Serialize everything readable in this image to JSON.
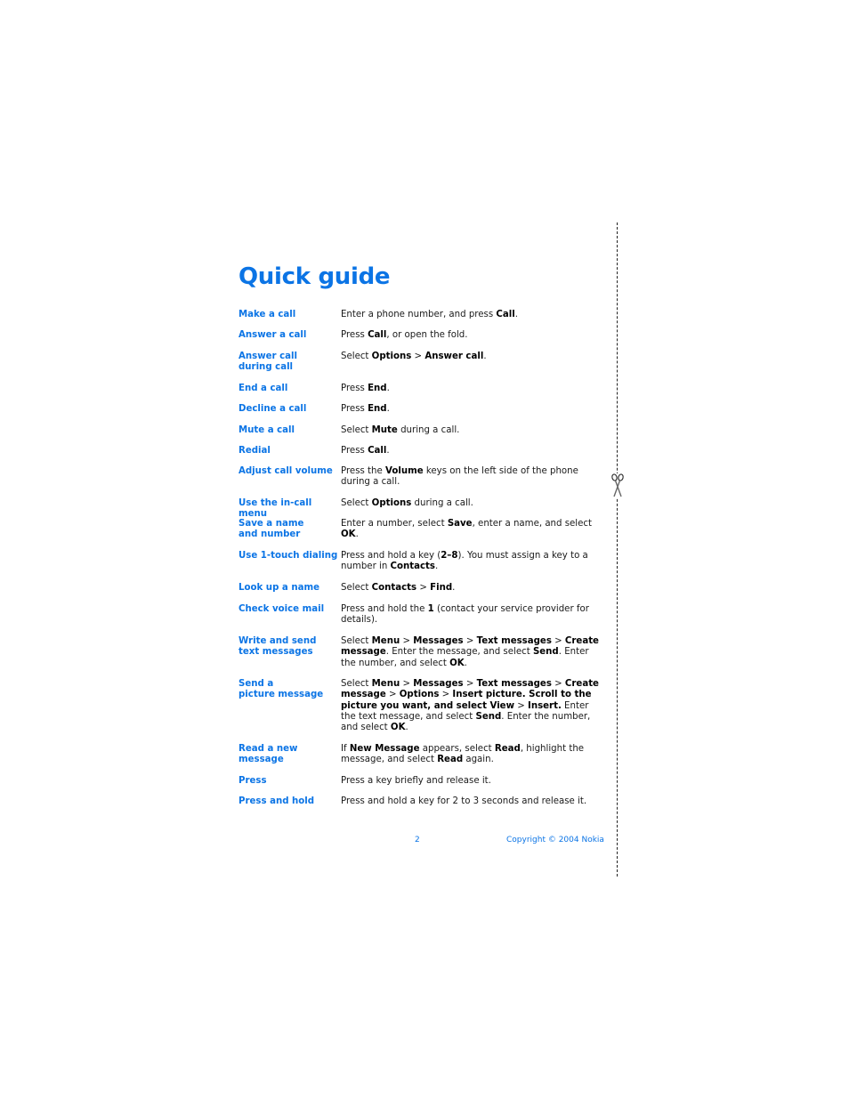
{
  "page": {
    "title": "Quick guide",
    "footer": {
      "page_number": "2",
      "copyright": "Copyright © 2004 Nokia"
    },
    "accent_color": "#0b74e5"
  },
  "rows": [
    {
      "term": "Make a call",
      "def": [
        [
          "Enter a phone number, and press ",
          false
        ],
        [
          "Call",
          true
        ],
        [
          ".",
          false
        ]
      ]
    },
    {
      "term": "Answer a call",
      "def": [
        [
          "Press ",
          false
        ],
        [
          "Call",
          true
        ],
        [
          ", or open the fold.",
          false
        ]
      ]
    },
    {
      "term": "Answer call\nduring call",
      "def": [
        [
          "Select ",
          false
        ],
        [
          "Options",
          true
        ],
        [
          " > ",
          false
        ],
        [
          "Answer call",
          true
        ],
        [
          ".",
          false
        ]
      ]
    },
    {
      "term": "End a call",
      "def": [
        [
          "Press ",
          false
        ],
        [
          "End",
          true
        ],
        [
          ".",
          false
        ]
      ]
    },
    {
      "term": "Decline a call",
      "def": [
        [
          "Press ",
          false
        ],
        [
          "End",
          true
        ],
        [
          ".",
          false
        ]
      ]
    },
    {
      "term": "Mute a call",
      "def": [
        [
          "Select ",
          false
        ],
        [
          "Mute",
          true
        ],
        [
          " during a call.",
          false
        ]
      ]
    },
    {
      "term": "Redial",
      "def": [
        [
          "Press ",
          false
        ],
        [
          "Call",
          true
        ],
        [
          ".",
          false
        ]
      ]
    },
    {
      "term": "Adjust call volume",
      "def": [
        [
          "Press the ",
          false
        ],
        [
          "Volume",
          true
        ],
        [
          " keys on the left side of the phone during a call.",
          false
        ]
      ]
    },
    {
      "term": "Use the in-call menu",
      "def": [
        [
          "Select ",
          false
        ],
        [
          "Options",
          true
        ],
        [
          " during a call.",
          false
        ]
      ]
    },
    {
      "term": "Save a name\nand number",
      "def": [
        [
          "Enter a number, select ",
          false
        ],
        [
          "Save",
          true
        ],
        [
          ", enter a name, and select ",
          false
        ],
        [
          "OK",
          true
        ],
        [
          ".",
          false
        ]
      ]
    },
    {
      "term": "Use 1-touch dialing",
      "def": [
        [
          "Press and hold a key (",
          false
        ],
        [
          "2–8",
          true
        ],
        [
          "). You must assign a key to a number in ",
          false
        ],
        [
          "Contacts",
          true
        ],
        [
          ".",
          false
        ]
      ]
    },
    {
      "term": "Look up a name",
      "def": [
        [
          "Select ",
          false
        ],
        [
          "Contacts",
          true
        ],
        [
          " > ",
          false
        ],
        [
          "Find",
          true
        ],
        [
          ".",
          false
        ]
      ]
    },
    {
      "term": "Check voice mail",
      "def": [
        [
          "Press and hold the ",
          false
        ],
        [
          "1",
          true
        ],
        [
          " (contact your service provider for details).",
          false
        ]
      ]
    },
    {
      "term": "Write and send\ntext messages",
      "def": [
        [
          "Select ",
          false
        ],
        [
          "Menu",
          true
        ],
        [
          " > ",
          false
        ],
        [
          "Messages",
          true
        ],
        [
          " > ",
          false
        ],
        [
          "Text messages",
          true
        ],
        [
          " > ",
          false
        ],
        [
          "Create message",
          true
        ],
        [
          ". Enter the message, and select ",
          false
        ],
        [
          "Send",
          true
        ],
        [
          ". Enter the number, and select ",
          false
        ],
        [
          "OK",
          true
        ],
        [
          ".",
          false
        ]
      ]
    },
    {
      "term": "Send a\npicture message",
      "def": [
        [
          "Select ",
          false
        ],
        [
          "Menu",
          true
        ],
        [
          " > ",
          false
        ],
        [
          "Messages",
          true
        ],
        [
          " > ",
          false
        ],
        [
          "Text messages",
          true
        ],
        [
          " > ",
          false
        ],
        [
          "Create message",
          true
        ],
        [
          " > ",
          false
        ],
        [
          "Options",
          true
        ],
        [
          " > ",
          false
        ],
        [
          "Insert picture. Scroll to the picture you want, and select View",
          true
        ],
        [
          " > ",
          false
        ],
        [
          "Insert.",
          true
        ],
        [
          " Enter the text message, and select ",
          false
        ],
        [
          "Send",
          true
        ],
        [
          ". Enter the number, and select ",
          false
        ],
        [
          "OK",
          true
        ],
        [
          ".",
          false
        ]
      ]
    },
    {
      "term": "Read a new message",
      "def": [
        [
          "If ",
          false
        ],
        [
          "New Message",
          true
        ],
        [
          " appears, select ",
          false
        ],
        [
          "Read",
          true
        ],
        [
          ", highlight the message, and select ",
          false
        ],
        [
          "Read",
          true
        ],
        [
          " again.",
          false
        ]
      ]
    },
    {
      "term": "Press",
      "def": [
        [
          "Press a key briefly and release it.",
          false
        ]
      ]
    },
    {
      "term": "Press and hold",
      "def": [
        [
          "Press and hold a key for 2 to 3 seconds and release it.",
          false
        ]
      ]
    }
  ],
  "icons": {
    "cut_mark": "scissors-icon"
  }
}
